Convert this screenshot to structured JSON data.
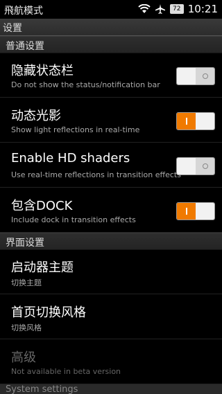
{
  "statusbar": {
    "carrier": "飛航模式",
    "battery": "72",
    "time": "10:21",
    "icons": [
      "wifi-icon",
      "airplane-icon",
      "battery-icon"
    ]
  },
  "titlebar": {
    "title": "设置"
  },
  "sections": {
    "general": "普通设置",
    "interface": "界面设置",
    "system": "System settings"
  },
  "rows": [
    {
      "title": "隐藏状态栏",
      "subtitle": "Do not show the status/notification bar",
      "toggle": false
    },
    {
      "title": "动态光影",
      "subtitle": "Show light reflections in real-time",
      "toggle": true
    },
    {
      "title": "Enable HD shaders",
      "subtitle": "Use real-time reflections in transition effects",
      "toggle": false
    },
    {
      "title": "包含DOCK",
      "subtitle": "Include dock in transition effects",
      "toggle": true
    },
    {
      "title": "启动器主题",
      "subtitle": "切换主题"
    },
    {
      "title": "首页切换风格",
      "subtitle": "切换风格"
    },
    {
      "title": "高级",
      "subtitle": "Not available in beta version",
      "disabled": true
    }
  ],
  "colors": {
    "accent": "#f07a00",
    "background": "#000000"
  }
}
